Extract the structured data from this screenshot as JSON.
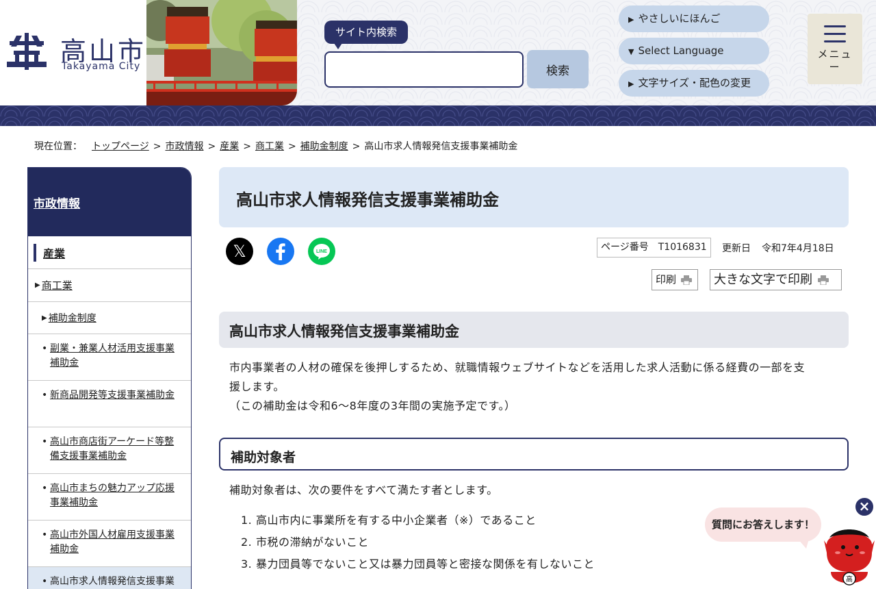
{
  "header": {
    "logo_ja": "高山市",
    "logo_en": "Takayama City",
    "search_label": "サイト内検索",
    "search_placeholder": "",
    "search_button": "検索",
    "lang_buttons": [
      "やさしいにほんご",
      "Select Language",
      "文字サイズ・配色の変更"
    ],
    "menu_label": "メニュー"
  },
  "breadcrumb": {
    "label": "現在位置：",
    "items": [
      "トップページ",
      "市政情報",
      "産業",
      "商工業",
      "補助金制度"
    ],
    "current": "高山市求人情報発信支援事業補助金",
    "separator": ">"
  },
  "sidebar": {
    "heading": "市政情報",
    "level1": "産業",
    "level2": "商工業",
    "level3": "補助金制度",
    "items": [
      "副業・兼業人材活用支援事業補助金",
      "新商品開発等支援事業補助金",
      "高山市商店街アーケード等整備支援事業補助金",
      "高山市まちの魅力アップ応援事業補助金",
      "高山市外国人材雇用支援事業補助金",
      "高山市求人情報発信支援事業補助金"
    ]
  },
  "main": {
    "title": "高山市求人情報発信支援事業補助金",
    "page_number_label": "ページ番号",
    "page_number": "T1016831",
    "updated_label": "更新日",
    "updated_date": "令和7年4月18日",
    "print_label": "印刷",
    "print_large_label": "大きな文字で印刷",
    "section_heading": "高山市求人情報発信支援事業補助金",
    "intro_line1": "市内事業者の人材の確保を後押しするため、就職情報ウェブサイトなどを活用した求人活動に係る経費の一部を支",
    "intro_line2": "援します。",
    "intro_line3": "（この補助金は令和6〜8年度の3年間の実施予定です。）",
    "subheading": "補助対象者",
    "target_intro": "補助対象者は、次の要件をすべて満たす者とします。",
    "requirements": [
      "高山市内に事業所を有する中小企業者（※）であること",
      "市税の滞納がないこと",
      "暴力団員等でないこと又は暴力団員等と密接な関係を有しないこと"
    ]
  },
  "sns": {
    "x_glyph": "𝕏"
  },
  "chatbot": {
    "bubble_text": "質問にお答えします！",
    "close_glyph": "×",
    "badge_text": "高"
  },
  "colors": {
    "navy": "#2b3268",
    "title_bg": "#dde8f6",
    "section_bg": "#e5e7ed",
    "facebook": "#1877f2",
    "line": "#06c755"
  }
}
